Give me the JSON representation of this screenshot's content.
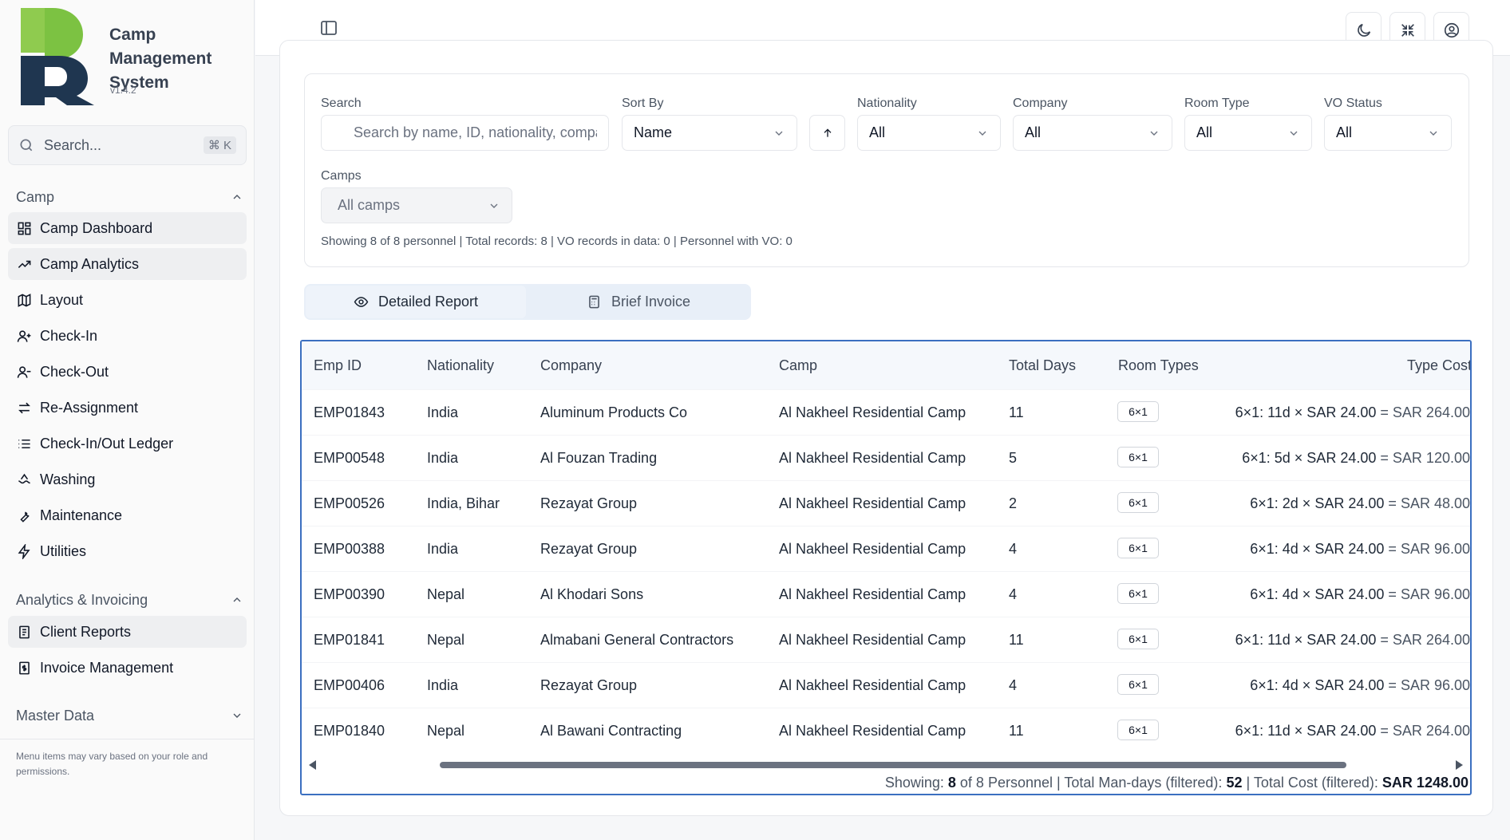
{
  "app": {
    "name": "Camp Management System",
    "version": "v1.4.2"
  },
  "sidebar": {
    "search_label": "Search...",
    "search_shortcut": "⌘ K",
    "sections": {
      "camp": "Camp",
      "analytics": "Analytics & Invoicing",
      "master": "Master Data"
    },
    "camp_items": [
      "Camp Dashboard",
      "Camp Analytics",
      "Layout",
      "Check-In",
      "Check-Out",
      "Re-Assignment",
      "Check-In/Out Ledger",
      "Washing",
      "Maintenance",
      "Utilities"
    ],
    "analytics_items": [
      "Client Reports",
      "Invoice Management"
    ],
    "note": "Menu items may vary based on your role and permissions."
  },
  "filters": {
    "search_label": "Search",
    "search_placeholder": "Search by name, ID, nationality, company...",
    "sort_label": "Sort By",
    "sort_value": "Name",
    "nationality_label": "Nationality",
    "nationality_value": "All",
    "company_label": "Company",
    "company_value": "All",
    "room_type_label": "Room Type",
    "room_type_value": "All",
    "vo_status_label": "VO Status",
    "vo_status_value": "All",
    "camps_label": "Camps",
    "camps_value": "All camps",
    "summary": "Showing 8 of 8 personnel | Total records: 8 | VO records in data: 0 | Personnel with VO: 0"
  },
  "tabs": {
    "detailed": "Detailed Report",
    "brief": "Brief Invoice"
  },
  "table": {
    "headers": [
      "Emp ID",
      "Nationality",
      "Company",
      "Camp",
      "Total Days",
      "Room Types",
      "Type Cost"
    ],
    "rows": [
      {
        "id": "EMP01843",
        "nationality": "India",
        "company": "Aluminum Products Co",
        "camp": "Al Nakheel Residential Camp",
        "days": "11",
        "room": "6×1",
        "calc": "6×1: 11d × SAR 24.00",
        "eq": "=",
        "total": "SAR 264.00"
      },
      {
        "id": "EMP00548",
        "nationality": "India",
        "company": "Al Fouzan Trading",
        "camp": "Al Nakheel Residential Camp",
        "days": "5",
        "room": "6×1",
        "calc": "6×1: 5d × SAR 24.00",
        "eq": "=",
        "total": "SAR 120.00"
      },
      {
        "id": "EMP00526",
        "nationality": "India, Bihar",
        "company": "Rezayat Group",
        "camp": "Al Nakheel Residential Camp",
        "days": "2",
        "room": "6×1",
        "calc": "6×1: 2d × SAR 24.00",
        "eq": "=",
        "total": "SAR 48.00"
      },
      {
        "id": "EMP00388",
        "nationality": "India",
        "company": "Rezayat Group",
        "camp": "Al Nakheel Residential Camp",
        "days": "4",
        "room": "6×1",
        "calc": "6×1: 4d × SAR 24.00",
        "eq": "=",
        "total": "SAR 96.00"
      },
      {
        "id": "EMP00390",
        "nationality": "Nepal",
        "company": "Al Khodari Sons",
        "camp": "Al Nakheel Residential Camp",
        "days": "4",
        "room": "6×1",
        "calc": "6×1: 4d × SAR 24.00",
        "eq": "=",
        "total": "SAR 96.00"
      },
      {
        "id": "EMP01841",
        "nationality": "Nepal",
        "company": "Almabani General Contractors",
        "camp": "Al Nakheel Residential Camp",
        "days": "11",
        "room": "6×1",
        "calc": "6×1: 11d × SAR 24.00",
        "eq": "=",
        "total": "SAR 264.00"
      },
      {
        "id": "EMP00406",
        "nationality": "India",
        "company": "Rezayat Group",
        "camp": "Al Nakheel Residential Camp",
        "days": "4",
        "room": "6×1",
        "calc": "6×1: 4d × SAR 24.00",
        "eq": "=",
        "total": "SAR 96.00"
      },
      {
        "id": "EMP01840",
        "nationality": "Nepal",
        "company": "Al Bawani Contracting",
        "camp": "Al Nakheel Residential Camp",
        "days": "11",
        "room": "6×1",
        "calc": "6×1: 11d × SAR 24.00",
        "eq": "=",
        "total": "SAR 264.00"
      }
    ],
    "footer": {
      "showing_prefix": "Showing:",
      "shown": "8",
      "of_text": "of 8 Personnel",
      "mandays_label": "Total Man-days (filtered):",
      "mandays_value": "52",
      "cost_label": "Total Cost (filtered):",
      "cost_value": "SAR 1248.00"
    }
  },
  "colors": {
    "accent_border": "#3b6fc0",
    "logo_green": "#7cc242",
    "logo_navy": "#1f3650"
  }
}
